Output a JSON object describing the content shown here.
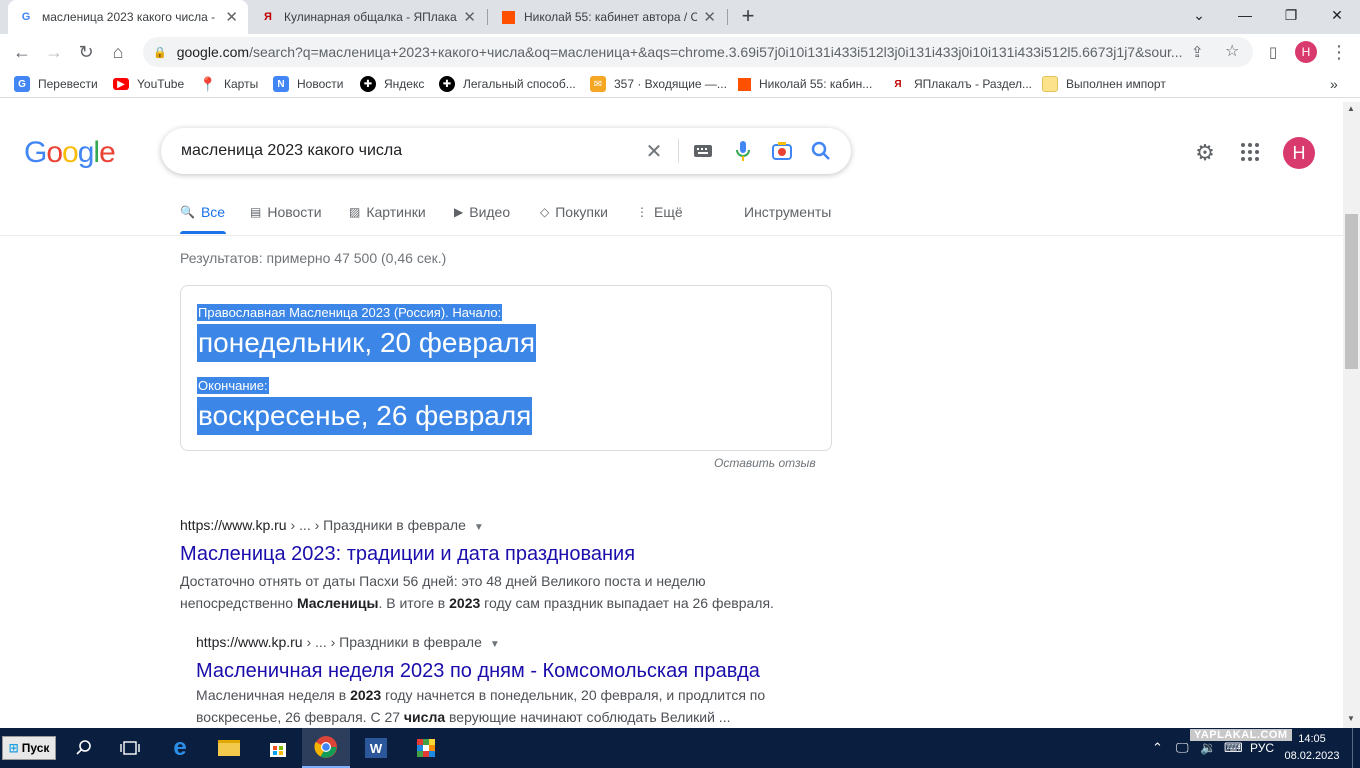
{
  "browser": {
    "tabs": [
      {
        "title": "масленица 2023 какого числа - ",
        "active": true
      },
      {
        "title": "Кулинарная общалка - ЯПлакал",
        "active": false
      },
      {
        "title": "Николай 55: кабинет автора / С",
        "active": false
      }
    ],
    "url_domain": "google.com",
    "url_path": "/search?q=масленица+2023+какого+числа&oq=масленица+&aqs=chrome.3.69i57j0i10i131i433i512l3j0i131i433j0i10i131i433i512l5.6673j1j7&sour...",
    "profile_letter": "Н"
  },
  "bookmarks": [
    {
      "label": "Перевести",
      "icon": "translate-icon",
      "color": "#4285f4"
    },
    {
      "label": "YouTube",
      "icon": "youtube-icon",
      "color": "#ff0000"
    },
    {
      "label": "Карты",
      "icon": "maps-icon",
      "color": "#34a853"
    },
    {
      "label": "Новости",
      "icon": "news-icon",
      "color": "#4285f4"
    },
    {
      "label": "Яндекс",
      "icon": "yandex-icon",
      "color": "#000000"
    },
    {
      "label": "Легальный способ...",
      "icon": "bookmark-icon",
      "color": "#000000"
    },
    {
      "label": "357 · Входящие —...",
      "icon": "mail-icon",
      "color": "#f5a623"
    },
    {
      "label": "Николай 55: кабин...",
      "icon": "square-icon",
      "color": "#ff5000"
    },
    {
      "label": "ЯПлакалъ - Раздел...",
      "icon": "yaplakal-icon",
      "color": "#c00000"
    },
    {
      "label": "Выполнен импорт",
      "icon": "folder-icon",
      "color": "#fce28a"
    }
  ],
  "google": {
    "logo": "Google",
    "query": "масленица 2023 какого числа",
    "profile_letter": "Н",
    "tabs": [
      {
        "label": "Все",
        "active": true
      },
      {
        "label": "Новости"
      },
      {
        "label": "Картинки"
      },
      {
        "label": "Видео"
      },
      {
        "label": "Покупки"
      },
      {
        "label": "Ещё"
      }
    ],
    "tools_label": "Инструменты",
    "stats": "Результатов: примерно 47 500 (0,46 сек.)"
  },
  "answer": {
    "start_label": "Православная Масленица 2023 (Россия). Начало:",
    "start_value": "понедельник, 20 февраля",
    "end_label": "Окончание:",
    "end_value": "воскресенье, 26 февраля",
    "feedback": "Оставить отзыв"
  },
  "results": [
    {
      "site": "https://www.kp.ru",
      "crumbs": " › ... › Праздники в феврале",
      "title": "Масленица 2023: традиции и дата празднования",
      "snippet_1": "Достаточно отнять от даты Пасхи 56 дней: это 48 дней Великого поста и неделю",
      "snippet_2a": "непосредственно ",
      "snippet_2b": "Масленицы",
      "snippet_2c": ". В итоге в ",
      "snippet_2d": "2023",
      "snippet_2e": " году сам праздник выпадает на 26 февраля."
    },
    {
      "site": "https://www.kp.ru",
      "crumbs": " › ... › Праздники в феврале",
      "title": "Масленичная неделя 2023 по дням - Комсомольская правда",
      "snippet_1a": "Масленичная неделя в ",
      "snippet_1b": "2023",
      "snippet_1c": " году начнется в понедельник, 20 февраля, и продлится по",
      "snippet_2a": "воскресенье, 26 февраля. С 27 ",
      "snippet_2b": "числа",
      "snippet_2c": " верующие начинают соблюдать Великий ..."
    }
  ],
  "taskbar": {
    "start_label": "Пуск",
    "lang": "РУС",
    "time": "14:05",
    "date": "08.02.2023",
    "watermark": "YAPLAKAL.COM"
  }
}
